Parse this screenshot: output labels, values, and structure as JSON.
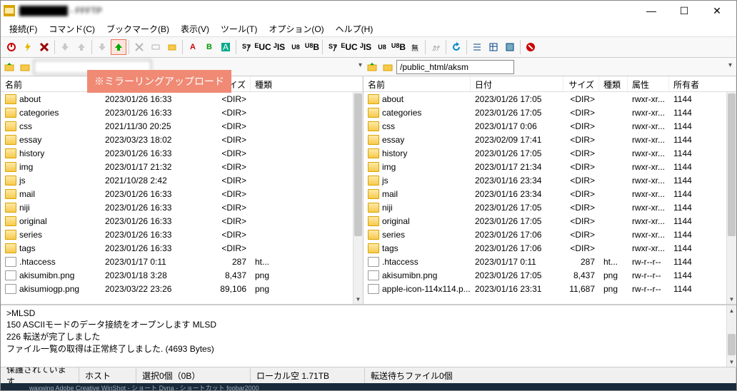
{
  "window": {
    "title": "████████ - FFFTP"
  },
  "menu": {
    "connect": "接続(F)",
    "command": "コマンド(C)",
    "bookmark": "ブックマーク(B)",
    "view": "表示(V)",
    "tool": "ツール(T)",
    "option": "オプション(O)",
    "help": "ヘルプ(H)"
  },
  "callout": "※ミラーリングアップロード",
  "path": {
    "left": "",
    "right": "/public_html/aksm"
  },
  "head": {
    "name": "名前",
    "date": "日付",
    "size": "サイズ",
    "type": "種類",
    "attr": "属性",
    "owner": "所有者"
  },
  "left": {
    "cols": {
      "name": 140,
      "date": 140,
      "size": 70,
      "type": 120
    },
    "rows": [
      {
        "icon": "folder",
        "name": "about",
        "date": "2023/01/26 16:33",
        "size": "<DIR>",
        "type": ""
      },
      {
        "icon": "folder",
        "name": "categories",
        "date": "2023/01/26 16:33",
        "size": "<DIR>",
        "type": ""
      },
      {
        "icon": "folder",
        "name": "css",
        "date": "2021/11/30 20:25",
        "size": "<DIR>",
        "type": ""
      },
      {
        "icon": "folder",
        "name": "essay",
        "date": "2023/03/23 18:02",
        "size": "<DIR>",
        "type": ""
      },
      {
        "icon": "folder",
        "name": "history",
        "date": "2023/01/26 16:33",
        "size": "<DIR>",
        "type": ""
      },
      {
        "icon": "folder",
        "name": "img",
        "date": "2023/01/17 21:32",
        "size": "<DIR>",
        "type": ""
      },
      {
        "icon": "folder",
        "name": "js",
        "date": "2021/10/28  2:42",
        "size": "<DIR>",
        "type": ""
      },
      {
        "icon": "folder",
        "name": "mail",
        "date": "2023/01/26 16:33",
        "size": "<DIR>",
        "type": ""
      },
      {
        "icon": "folder",
        "name": "niji",
        "date": "2023/01/26 16:33",
        "size": "<DIR>",
        "type": ""
      },
      {
        "icon": "folder",
        "name": "original",
        "date": "2023/01/26 16:33",
        "size": "<DIR>",
        "type": ""
      },
      {
        "icon": "folder",
        "name": "series",
        "date": "2023/01/26 16:33",
        "size": "<DIR>",
        "type": ""
      },
      {
        "icon": "folder",
        "name": "tags",
        "date": "2023/01/26 16:33",
        "size": "<DIR>",
        "type": ""
      },
      {
        "icon": "file",
        "name": ".htaccess",
        "date": "2023/01/17  0:11",
        "size": "287",
        "type": "ht..."
      },
      {
        "icon": "file",
        "name": "akisumibn.png",
        "date": "2023/01/18  3:28",
        "size": "8,437",
        "type": "png"
      },
      {
        "icon": "file",
        "name": "akisumiogp.png",
        "date": "2023/03/22 23:26",
        "size": "89,106",
        "type": "png"
      }
    ]
  },
  "right": {
    "cols": {
      "name": 150,
      "date": 130,
      "size": 50,
      "type": 40,
      "attr": 58,
      "owner": 50
    },
    "rows": [
      {
        "icon": "folder",
        "name": "about",
        "date": "2023/01/26 17:05",
        "size": "<DIR>",
        "type": "",
        "attr": "rwxr-xr...",
        "owner": "1144"
      },
      {
        "icon": "folder",
        "name": "categories",
        "date": "2023/01/26 17:05",
        "size": "<DIR>",
        "type": "",
        "attr": "rwxr-xr...",
        "owner": "1144"
      },
      {
        "icon": "folder",
        "name": "css",
        "date": "2023/01/17  0:06",
        "size": "<DIR>",
        "type": "",
        "attr": "rwxr-xr...",
        "owner": "1144"
      },
      {
        "icon": "folder",
        "name": "essay",
        "date": "2023/02/09 17:41",
        "size": "<DIR>",
        "type": "",
        "attr": "rwxr-xr...",
        "owner": "1144"
      },
      {
        "icon": "folder",
        "name": "history",
        "date": "2023/01/26 17:05",
        "size": "<DIR>",
        "type": "",
        "attr": "rwxr-xr...",
        "owner": "1144"
      },
      {
        "icon": "folder",
        "name": "img",
        "date": "2023/01/17 21:34",
        "size": "<DIR>",
        "type": "",
        "attr": "rwxr-xr...",
        "owner": "1144"
      },
      {
        "icon": "folder",
        "name": "js",
        "date": "2023/01/16 23:34",
        "size": "<DIR>",
        "type": "",
        "attr": "rwxr-xr...",
        "owner": "1144"
      },
      {
        "icon": "folder",
        "name": "mail",
        "date": "2023/01/16 23:34",
        "size": "<DIR>",
        "type": "",
        "attr": "rwxr-xr...",
        "owner": "1144"
      },
      {
        "icon": "folder",
        "name": "niji",
        "date": "2023/01/26 17:05",
        "size": "<DIR>",
        "type": "",
        "attr": "rwxr-xr...",
        "owner": "1144"
      },
      {
        "icon": "folder",
        "name": "original",
        "date": "2023/01/26 17:05",
        "size": "<DIR>",
        "type": "",
        "attr": "rwxr-xr...",
        "owner": "1144"
      },
      {
        "icon": "folder",
        "name": "series",
        "date": "2023/01/26 17:06",
        "size": "<DIR>",
        "type": "",
        "attr": "rwxr-xr...",
        "owner": "1144"
      },
      {
        "icon": "folder",
        "name": "tags",
        "date": "2023/01/26 17:06",
        "size": "<DIR>",
        "type": "",
        "attr": "rwxr-xr...",
        "owner": "1144"
      },
      {
        "icon": "file",
        "name": ".htaccess",
        "date": "2023/01/17  0:11",
        "size": "287",
        "type": "ht...",
        "attr": "rw-r--r--",
        "owner": "1144"
      },
      {
        "icon": "file",
        "name": "akisumibn.png",
        "date": "2023/01/26 17:05",
        "size": "8,437",
        "type": "png",
        "attr": "rw-r--r--",
        "owner": "1144"
      },
      {
        "icon": "file",
        "name": "apple-icon-114x114.p...",
        "date": "2023/01/16 23:31",
        "size": "11,687",
        "type": "png",
        "attr": "rw-r--r--",
        "owner": "1144"
      }
    ]
  },
  "log": {
    "l1": ">MLSD",
    "l2": "150 ASCIIモードのデータ接続をオープンします  MLSD",
    "l3": "226 転送が完了しました",
    "l4": "ファイル一覧の取得は正常終了しました. (4693 Bytes)"
  },
  "status": {
    "secure": "保護されています",
    "host": "ホスト",
    "sel": "選択0個（0B）",
    "local": "ローカル空  1.71TB",
    "queue": "転送待ちファイル0個"
  },
  "taskbar": "waxwing    Adobe Creative    WinShot - ショート    Dyna - ショートカット    foobar2000"
}
